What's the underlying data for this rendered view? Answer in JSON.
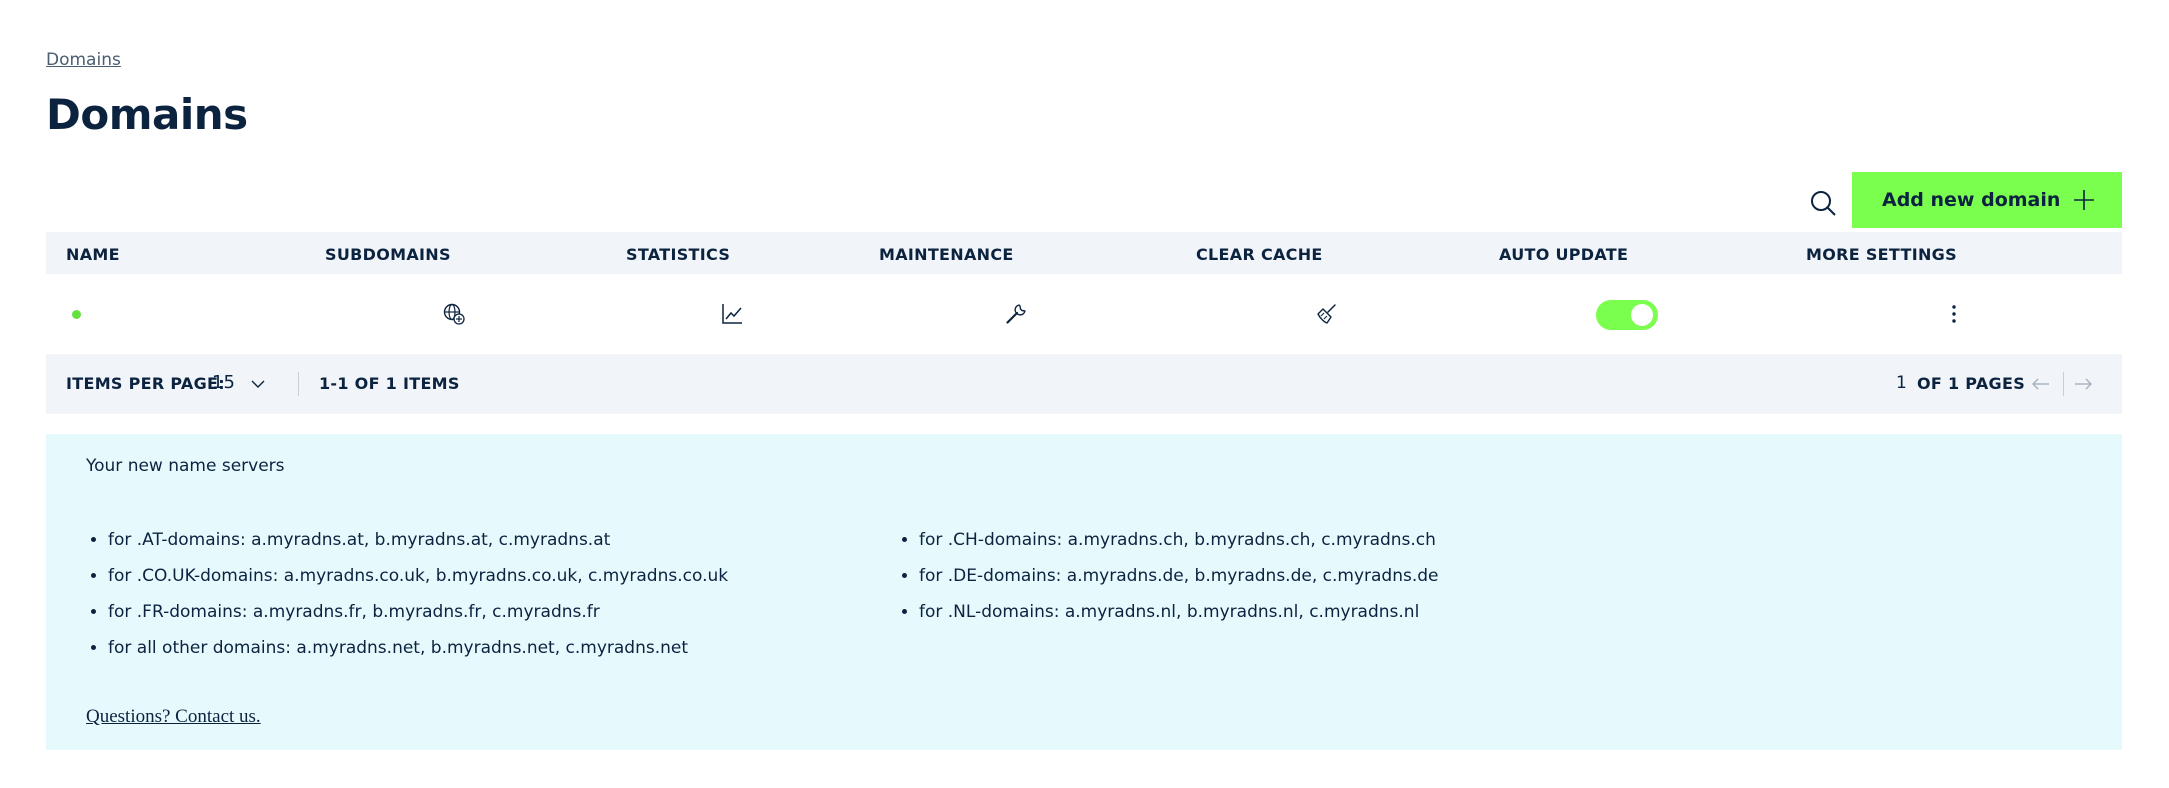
{
  "breadcrumb": {
    "label": "Domains"
  },
  "page": {
    "title": "Domains"
  },
  "actions": {
    "add_label": "Add new domain",
    "search_icon": "search-icon",
    "add_icon": "plus-icon"
  },
  "table": {
    "columns": [
      "NAME",
      "SUBDOMAINS",
      "STATISTICS",
      "MAINTENANCE",
      "CLEAR CACHE",
      "AUTO UPDATE",
      "MORE SETTINGS"
    ],
    "rows": [
      {
        "name": "",
        "status": "active",
        "status_color": "#63e23f",
        "subdomains_icon": "globe-icon",
        "statistics_icon": "chart-icon",
        "maintenance_icon": "wrench-icon",
        "clear_cache_icon": "broom-icon",
        "auto_update": true,
        "more_icon": "more-vertical-icon"
      }
    ]
  },
  "pagination": {
    "items_per_page_label": "ITEMS PER PAGE:",
    "items_per_page": "15",
    "range": "1-1 OF 1 ITEMS",
    "current_page": "1",
    "pages_label": "OF 1 PAGES"
  },
  "info": {
    "heading": "Your new name servers",
    "col1": [
      "for .AT-domains: a.myradns.at, b.myradns.at, c.myradns.at",
      "for .CO.UK-domains: a.myradns.co.uk, b.myradns.co.uk, c.myradns.co.uk",
      "for .FR-domains: a.myradns.fr, b.myradns.fr, c.myradns.fr",
      "for all other domains: a.myradns.net, b.myradns.net, c.myradns.net"
    ],
    "col2": [
      "for .CH-domains: a.myradns.ch, b.myradns.ch, c.myradns.ch",
      "for .DE-domains: a.myradns.de, b.myradns.de, c.myradns.de",
      "for .NL-domains: a.myradns.nl, b.myradns.nl, c.myradns.nl"
    ],
    "contact_link": "Questions? Contact us."
  },
  "colors": {
    "accent": "#7bff4f",
    "text": "#0c2340",
    "header_bg": "#f1f4f8",
    "info_bg": "#e6f9fd"
  }
}
